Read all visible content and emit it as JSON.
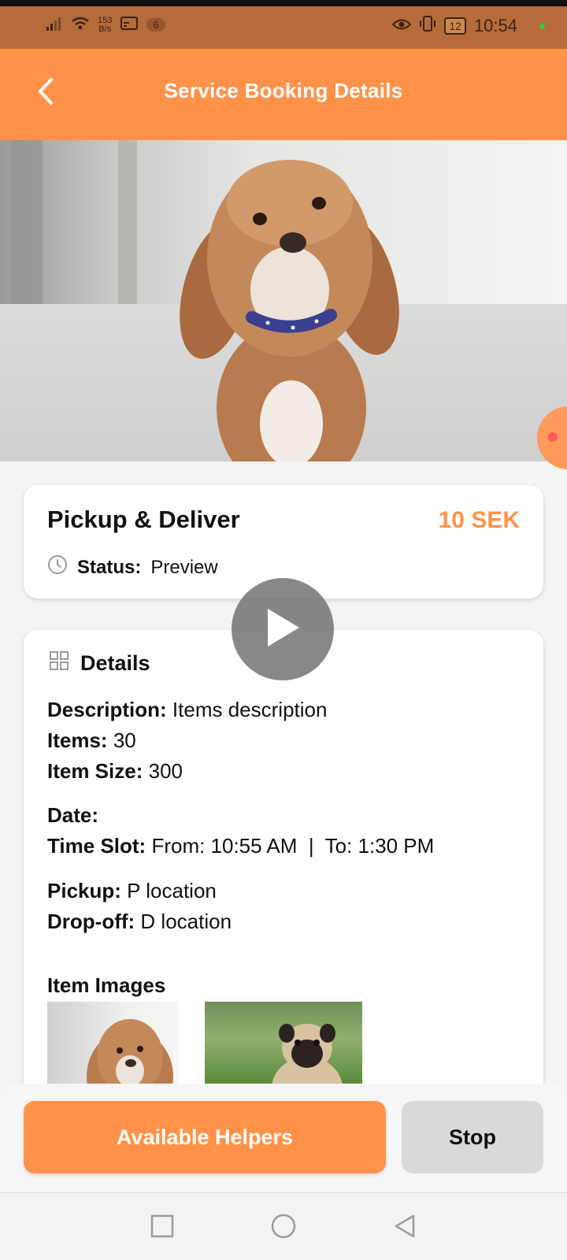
{
  "status_bar": {
    "net_speed": "153\nB/s",
    "notif_count": "6",
    "battery": "12",
    "time": "10:54"
  },
  "header": {
    "title": "Service Booking Details"
  },
  "summary": {
    "service_name": "Pickup & Deliver",
    "price": "10 SEK",
    "status_label": "Status:",
    "status_value": "Preview"
  },
  "details": {
    "title": "Details",
    "description_label": "Description:",
    "description_value": "Items description",
    "items_label": "Items:",
    "items_value": "30",
    "item_size_label": "Item Size:",
    "item_size_value": "300",
    "date_label": "Date:",
    "date_value": "",
    "time_slot_label": "Time Slot:",
    "time_slot_value": "From: 10:55 AM  |  To: 1:30 PM",
    "pickup_label": "Pickup:",
    "pickup_value": "P location",
    "dropoff_label": "Drop-off:",
    "dropoff_value": "D location",
    "images_title": "Item Images"
  },
  "actions": {
    "helpers_label": "Available Helpers",
    "stop_label": "Stop"
  },
  "colors": {
    "accent": "#ff9248",
    "status_bar": "#b76a3a"
  }
}
